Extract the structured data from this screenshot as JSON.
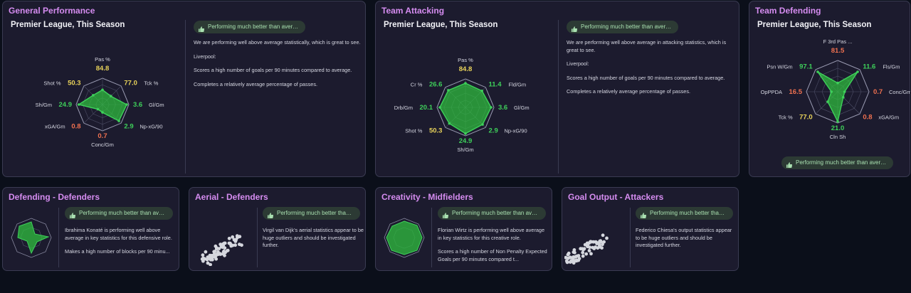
{
  "colors": {
    "accent_title": "#d58cf0",
    "good": "#3ed05a",
    "average": "#e9d35a",
    "bad": "#f07150",
    "badge_bg": "#2c3a34",
    "badge_text": "#a9e0b0",
    "card_bg": "#1c1b2e"
  },
  "general_performance": {
    "title": "General Performance",
    "subtitle": "Premier League, This Season",
    "badge": "Performing much better than average",
    "description": [
      "We are performing well above average statistically, which is great to see.",
      "Liverpool:",
      "Scores a high number of goals per 90 minutes compared to average.",
      "Completes a relatively average percentage of passes."
    ],
    "radar": [
      {
        "label": "Pas %",
        "value": "84.8",
        "level": 0.56,
        "color": "yellow"
      },
      {
        "label": "Tck %",
        "value": "77.0",
        "level": 0.45,
        "color": "yellow"
      },
      {
        "label": "Gl/Gm",
        "value": "3.6",
        "level": 0.92,
        "color": "green"
      },
      {
        "label": "Np-xG/90",
        "value": "2.9",
        "level": 0.88,
        "color": "green"
      },
      {
        "label": "Conc/Gm",
        "value": "0.7",
        "level": 0.3,
        "color": "red"
      },
      {
        "label": "xGA/Gm",
        "value": "0.8",
        "level": 0.25,
        "color": "red"
      },
      {
        "label": "Sh/Gm",
        "value": "24.9",
        "level": 0.9,
        "color": "green"
      },
      {
        "label": "Shot %",
        "value": "50.3",
        "level": 0.5,
        "color": "yellow"
      }
    ]
  },
  "team_attacking": {
    "title": "Team Attacking",
    "subtitle": "Premier League, This Season",
    "badge": "Performing much better than average",
    "description": [
      "We are performing well above average in attacking statistics, which is great to see.",
      "Liverpool:",
      "Scores a high number of goals per 90 minutes compared to average.",
      "Completes a relatively average percentage of passes."
    ],
    "radar": [
      {
        "label": "Pas %",
        "value": "84.8",
        "level": 0.85,
        "color": "yellow"
      },
      {
        "label": "Fld/Gm",
        "value": "11.4",
        "level": 0.82,
        "color": "green"
      },
      {
        "label": "Gl/Gm",
        "value": "3.6",
        "level": 0.9,
        "color": "green"
      },
      {
        "label": "Np-xG/90",
        "value": "2.9",
        "level": 0.85,
        "color": "green"
      },
      {
        "label": "Sh/Gm",
        "value": "24.9",
        "level": 0.92,
        "color": "green"
      },
      {
        "label": "Shot %",
        "value": "50.3",
        "level": 0.8,
        "color": "yellow"
      },
      {
        "label": "Drb/Gm",
        "value": "20.1",
        "level": 0.9,
        "color": "green"
      },
      {
        "label": "Cr %",
        "value": "26.6",
        "level": 0.85,
        "color": "green"
      }
    ]
  },
  "team_defending": {
    "title": "Team Defending",
    "subtitle": "Premier League, This Season",
    "badge": "Performing much better than average",
    "radar": [
      {
        "label": "F 3rd Pas ...",
        "value": "81.5",
        "level": 0.28,
        "color": "red"
      },
      {
        "label": "Fls/Gm",
        "value": "11.6",
        "level": 0.9,
        "color": "green"
      },
      {
        "label": "Conc/Gm",
        "value": "0.7",
        "level": 0.22,
        "color": "red"
      },
      {
        "label": "xGA/Gm",
        "value": "0.8",
        "level": 0.25,
        "color": "red"
      },
      {
        "label": "Cln Sh",
        "value": "21.0",
        "level": 0.95,
        "color": "green"
      },
      {
        "label": "Tck %",
        "value": "77.0",
        "level": 0.45,
        "color": "yellow"
      },
      {
        "label": "OpPPDA",
        "value": "16.5",
        "level": 0.2,
        "color": "red"
      },
      {
        "label": "Psn W/Gm",
        "value": "97.1",
        "level": 0.9,
        "color": "green"
      }
    ]
  },
  "defending_defenders": {
    "title": "Defending - Defenders",
    "badge": "Performing much better than avera...",
    "description": [
      "Ibrahima Konaté is performing well above average in key statistics for this defensive role.",
      "Makes a high number of blocks per 90 minu..."
    ]
  },
  "aerial_defenders": {
    "title": "Aerial - Defenders",
    "badge": "Performing much better than ...",
    "description": [
      "Virgil van Dijk's aerial statistics appear to be huge outliers and should be investigated further."
    ]
  },
  "creativity_midfielders": {
    "title": "Creativity - Midfielders",
    "badge": "Performing much better than avera...",
    "description": [
      "Florian Wirtz is performing well above average in key statistics for this creative role.",
      "Scores a high number of Non Penalty Expected Goals per 90 minutes compared t..."
    ]
  },
  "goal_output_attackers": {
    "title": "Goal Output - Attackers",
    "badge": "Performing much better than ...",
    "description": [
      "Federico Chiesa's output statistics appear to be huge outliers and should be investigated further."
    ]
  }
}
